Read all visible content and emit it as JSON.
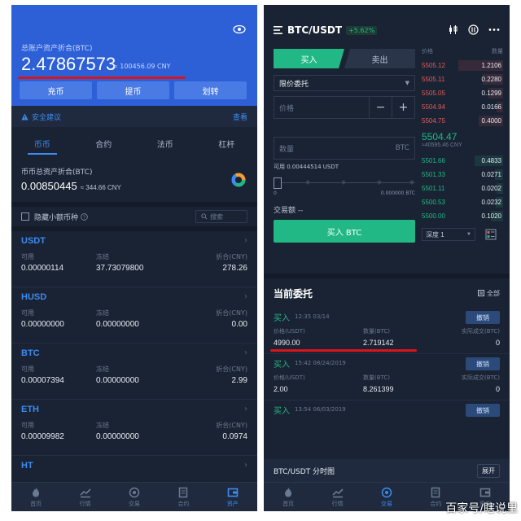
{
  "left": {
    "asset_label": "总账户资产折合(BTC)",
    "asset_value": "2.47867573",
    "asset_cny": "≈ 100456.09 CNY",
    "buttons": [
      "充币",
      "提币",
      "划转"
    ],
    "advice_label": "安全建议",
    "advice_link": "查看",
    "tabs": [
      "币币",
      "合约",
      "法币",
      "杠杆"
    ],
    "coin_total_label": "币币总资产折合(BTC)",
    "coin_total_value": "0.00850445",
    "coin_total_cny": "≈ 344.66 CNY",
    "hide_small_label": "隐藏小额币种",
    "search_placeholder": "搜索",
    "col_labels": {
      "available": "可用",
      "frozen": "冻结",
      "cny": "折合(CNY)"
    },
    "coins": [
      {
        "name": "USDT",
        "available": "0.00000114",
        "frozen": "37.73079800",
        "cny": "278.26"
      },
      {
        "name": "HUSD",
        "available": "0.00000000",
        "frozen": "0.00000000",
        "cny": "0.00"
      },
      {
        "name": "BTC",
        "available": "0.00007394",
        "frozen": "0.00000000",
        "cny": "2.99"
      },
      {
        "name": "ETH",
        "available": "0.00009982",
        "frozen": "0.00000000",
        "cny": "0.0974"
      },
      {
        "name": "HT"
      }
    ],
    "nav": [
      "首页",
      "行情",
      "交易",
      "合约",
      "资产"
    ]
  },
  "right": {
    "pair": "BTC/USDT",
    "change": "+5.62%",
    "buy_tab": "买入",
    "sell_tab": "卖出",
    "order_type": "限价委托",
    "price_placeholder": "价格",
    "qty_placeholder": "数量",
    "qty_unit": "BTC",
    "available": "可用 0.00444514 USDT",
    "slider_min": "0",
    "slider_max": "0.000000 BTC",
    "trade_amount": "交易额  --",
    "buy_button": "买入 BTC",
    "ob_headers": {
      "price": "价格",
      "qty": "数量"
    },
    "asks": [
      {
        "price": "5505.12",
        "qty": "1.2106",
        "fill": 0.55
      },
      {
        "price": "5505.11",
        "qty": "0.2280",
        "fill": 0.25
      },
      {
        "price": "5505.05",
        "qty": "0.1299",
        "fill": 0.18
      },
      {
        "price": "5504.94",
        "qty": "0.0166",
        "fill": 0.08
      },
      {
        "price": "5504.75",
        "qty": "0.4000",
        "fill": 0.3
      }
    ],
    "last_price": "5504.47",
    "last_cny": "≈40595.46 CNY",
    "bids": [
      {
        "price": "5501.66",
        "qty": "0.4833",
        "fill": 0.35
      },
      {
        "price": "5501.33",
        "qty": "0.0271",
        "fill": 0.1
      },
      {
        "price": "5501.11",
        "qty": "0.0202",
        "fill": 0.08
      },
      {
        "price": "5500.53",
        "qty": "0.0232",
        "fill": 0.09
      },
      {
        "price": "5500.00",
        "qty": "0.1020",
        "fill": 0.15
      }
    ],
    "depth": "深度 1",
    "orders_title": "当前委托",
    "orders_all": "全部",
    "order_cols": {
      "price": "价格(USDT)",
      "qty": "数量(BTC)",
      "filled": "实际成交(BTC)"
    },
    "orders": [
      {
        "side": "买入",
        "time": "12:35 03/14",
        "cancel": "撤销",
        "price": "4990.00",
        "qty": "2.719142",
        "filled": "0"
      },
      {
        "side": "买入",
        "time": "15:42 08/24/2019",
        "cancel": "撤销",
        "price": "2.00",
        "qty": "8.261399",
        "filled": "0"
      },
      {
        "side": "买入",
        "time": "13:54 06/03/2019",
        "cancel": "撤销"
      }
    ],
    "chart_label": "BTC/USDT 分时图",
    "expand": "展开",
    "nav": [
      "首页",
      "行情",
      "交易",
      "合约",
      "资产"
    ]
  },
  "watermark": "百家号/瞎说里"
}
